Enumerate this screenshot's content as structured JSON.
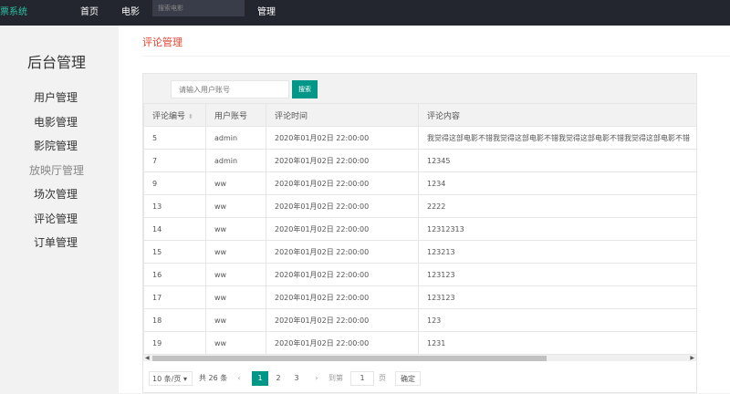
{
  "topbar": {
    "brand": "票系统",
    "nav": [
      "首页",
      "电影"
    ],
    "search_placeholder": "搜索电影",
    "manage": "管理"
  },
  "sidebar": {
    "title": "后台管理",
    "items": [
      "用户管理",
      "电影管理",
      "影院管理",
      "放映厅管理",
      "场次管理",
      "评论管理",
      "订单管理"
    ]
  },
  "main": {
    "page_title": "评论管理",
    "search_placeholder": "请输入用户账号",
    "search_button": "搜索"
  },
  "table": {
    "headers": [
      "评论编号",
      "用户账号",
      "评论时间",
      "评论内容"
    ],
    "rows": [
      [
        "5",
        "admin",
        "2020年01月02日 22:00:00",
        "我觉得这部电影不错我觉得这部电影不错我觉得这部电影不错我觉得这部电影不错"
      ],
      [
        "7",
        "admin",
        "2020年01月02日 22:00:00",
        "12345"
      ],
      [
        "9",
        "ww",
        "2020年01月02日 22:00:00",
        "1234"
      ],
      [
        "13",
        "ww",
        "2020年01月02日 22:00:00",
        "2222"
      ],
      [
        "14",
        "ww",
        "2020年01月02日 22:00:00",
        "12312313"
      ],
      [
        "15",
        "ww",
        "2020年01月02日 22:00:00",
        "123213"
      ],
      [
        "16",
        "ww",
        "2020年01月02日 22:00:00",
        "123123"
      ],
      [
        "17",
        "ww",
        "2020年01月02日 22:00:00",
        "123123"
      ],
      [
        "18",
        "ww",
        "2020年01月02日 22:00:00",
        "123"
      ],
      [
        "19",
        "ww",
        "2020年01月02日 22:00:00",
        "1231"
      ]
    ]
  },
  "pagination": {
    "limit": "10 条/页",
    "total": "共 26 条",
    "pages": [
      "1",
      "2",
      "3"
    ],
    "current": "1",
    "goto_label": "到第",
    "goto_value": "1",
    "page_unit": "页",
    "confirm": "确定"
  },
  "colors": {
    "topbar": "#23262e",
    "accent": "#009688",
    "title": "#e0452f",
    "brand": "#2ec1a8"
  }
}
